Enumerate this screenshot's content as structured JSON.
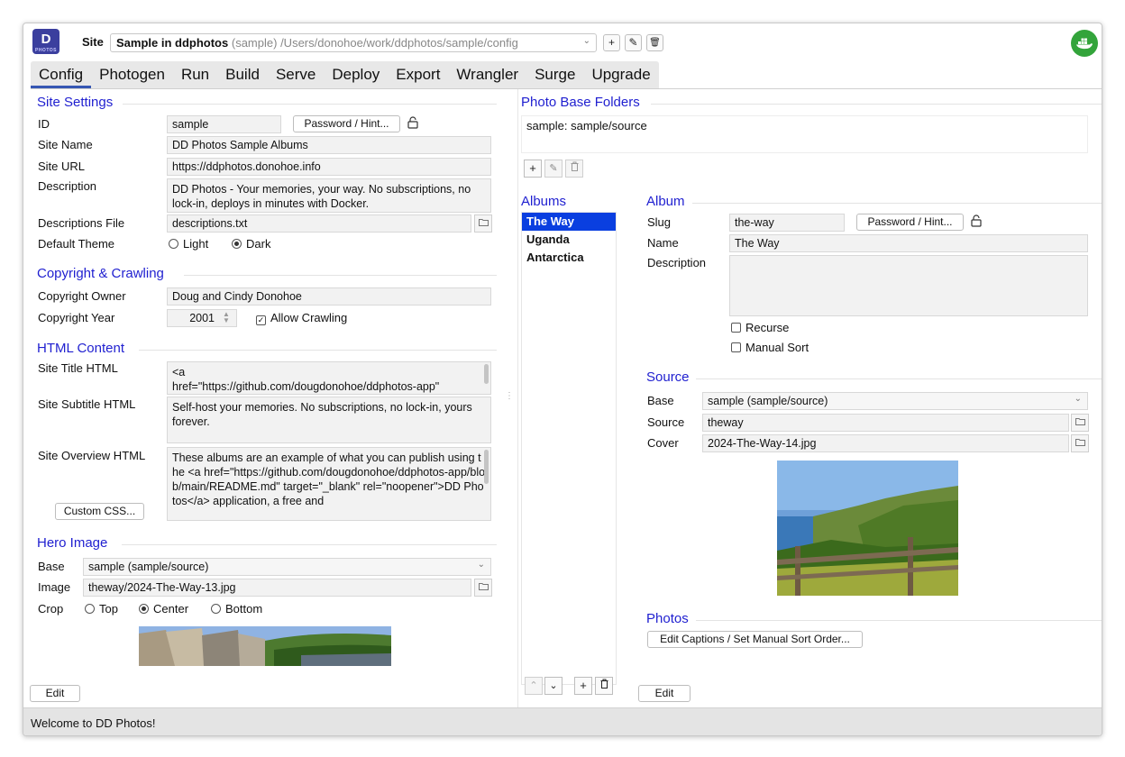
{
  "header": {
    "logo_text": "D",
    "logo_sub": "PHOTOS",
    "site_label": "Site",
    "site_name": "Sample in ddphotos",
    "site_id_hint": "(sample)",
    "site_path": "/Users/donohoe/work/ddphotos/sample/config",
    "add_icon": "+",
    "edit_icon": "✎",
    "delete_icon": "🗑"
  },
  "tabs": [
    "Config",
    "Photogen",
    "Run",
    "Build",
    "Serve",
    "Deploy",
    "Export",
    "Wrangler",
    "Surge",
    "Upgrade"
  ],
  "site_settings": {
    "title": "Site Settings",
    "id_label": "ID",
    "id_value": "sample",
    "password_button": "Password / Hint...",
    "site_name_label": "Site Name",
    "site_name_value": "DD Photos Sample Albums",
    "site_url_label": "Site URL",
    "site_url_value": "https://ddphotos.donohoe.info",
    "description_label": "Description",
    "description_value": "DD Photos - Your memories, your way. No subscriptions, no lock-in, deploys in minutes with Docker.",
    "descriptions_file_label": "Descriptions File",
    "descriptions_file_value": "descriptions.txt",
    "default_theme_label": "Default Theme",
    "theme_light": "Light",
    "theme_dark": "Dark"
  },
  "copyright": {
    "title": "Copyright & Crawling",
    "owner_label": "Copyright Owner",
    "owner_value": "Doug and Cindy Donohoe",
    "year_label": "Copyright Year",
    "year_value": "2001",
    "allow_crawling": "Allow Crawling"
  },
  "html_content": {
    "title": "HTML Content",
    "site_title_label": "Site Title HTML",
    "site_title_value": "<a\nhref=\"https://github.com/dougdonohoe/ddphotos-app\"",
    "site_subtitle_label": "Site Subtitle HTML",
    "site_subtitle_value": "Self-host your memories. No subscriptions, no lock-in, yours forever.",
    "site_overview_label": "Site Overview HTML",
    "site_overview_value": "These albums are an example of what you can publish using the  <a href=\"https://github.com/dougdonohoe/ddphotos-app/blob/main/README.md\" target=\"_blank\" rel=\"noopener\">DD Photos</a> application, a free and",
    "custom_css_button": "Custom CSS..."
  },
  "hero": {
    "title": "Hero Image",
    "base_label": "Base",
    "base_value": "sample (sample/source)",
    "image_label": "Image",
    "image_value": "theway/2024-The-Way-13.jpg",
    "crop_label": "Crop",
    "crop_top": "Top",
    "crop_center": "Center",
    "crop_bottom": "Bottom"
  },
  "left_edit_button": "Edit",
  "photo_base": {
    "title": "Photo Base Folders",
    "entry": "sample: sample/source"
  },
  "albums": {
    "title": "Albums",
    "items": [
      "The Way",
      "Uganda",
      "Antarctica"
    ]
  },
  "album": {
    "title": "Album",
    "slug_label": "Slug",
    "slug_value": "the-way",
    "password_button": "Password / Hint...",
    "name_label": "Name",
    "name_value": "The Way",
    "description_label": "Description",
    "recurse": "Recurse",
    "manual_sort": "Manual Sort"
  },
  "source": {
    "title": "Source",
    "base_label": "Base",
    "base_value": "sample (sample/source)",
    "source_label": "Source",
    "source_value": "theway",
    "cover_label": "Cover",
    "cover_value": "2024-The-Way-14.jpg"
  },
  "photos": {
    "title": "Photos",
    "captions_button": "Edit Captions / Set Manual Sort Order..."
  },
  "right_edit_button": "Edit",
  "status_text": "Welcome to DD Photos!"
}
